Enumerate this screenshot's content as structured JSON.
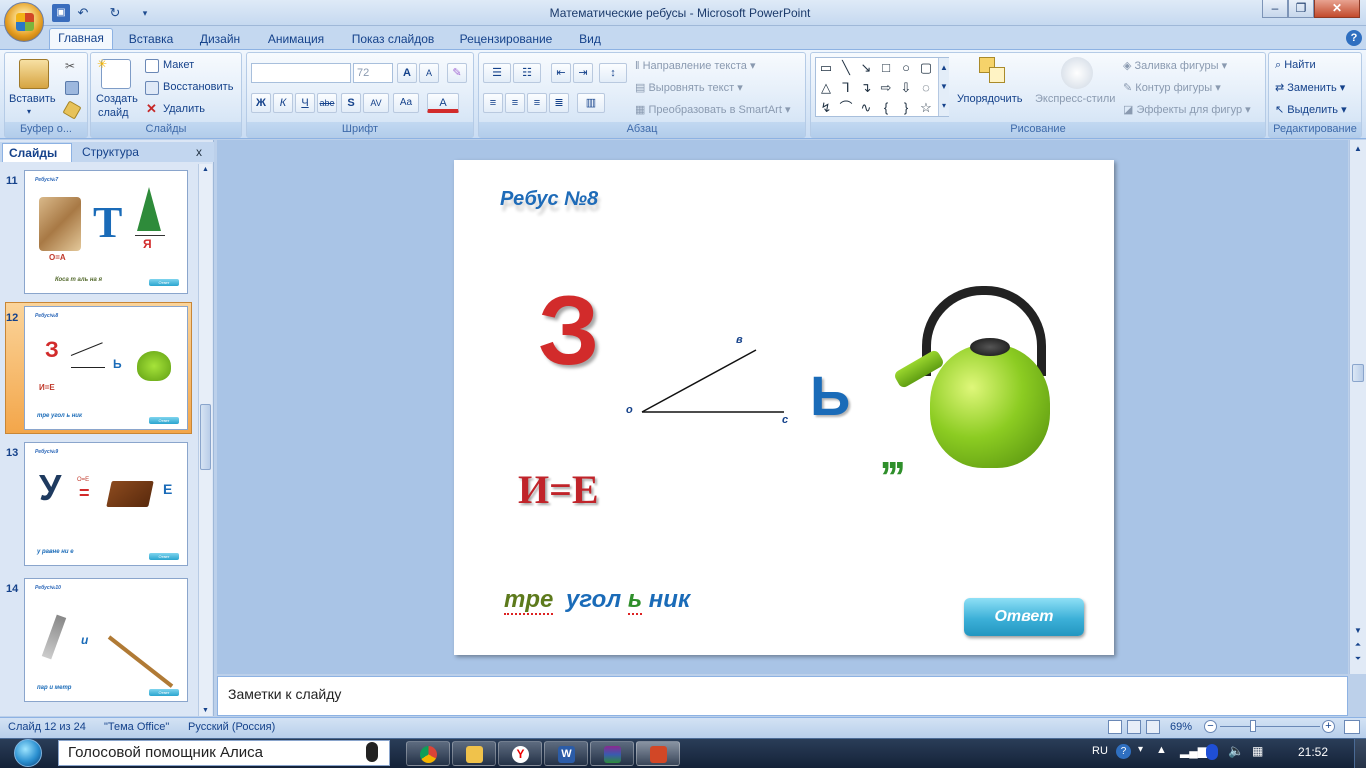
{
  "window": {
    "title": "Математические ребусы - Microsoft PowerPoint",
    "controls": [
      "–",
      "❐",
      "✕"
    ]
  },
  "quick_access": {
    "save_icon": "save-icon",
    "undo_icon": "undo-icon",
    "redo_icon": "redo-icon"
  },
  "tabs": [
    "Главная",
    "Вставка",
    "Дизайн",
    "Анимация",
    "Показ слайдов",
    "Рецензирование",
    "Вид"
  ],
  "ribbon": {
    "clipboard": {
      "paste": "Вставить",
      "label": "Буфер о..."
    },
    "slides": {
      "new_slide_line1": "Создать",
      "new_slide_line2": "слайд",
      "layout": "Макет",
      "reset": "Восстановить",
      "delete": "Удалить",
      "label": "Слайды"
    },
    "font": {
      "size": "72",
      "grow": "A",
      "shrink": "A",
      "bold": "Ж",
      "italic": "К",
      "underline": "Ч",
      "strike": "abe",
      "shadow": "S",
      "spacing": "AV",
      "case": "Aa",
      "color": "A",
      "label": "Шрифт"
    },
    "paragraph": {
      "text_direction": "Направление текста",
      "align_text": "Выровнять текст",
      "smartart": "Преобразовать в SmartArt",
      "label": "Абзац"
    },
    "drawing": {
      "arrange": "Упорядочить",
      "quick_styles": "Экспресс-стили",
      "fill": "Заливка фигуры",
      "outline": "Контур фигуры",
      "effects": "Эффекты для фигур",
      "label": "Рисование"
    },
    "editing": {
      "find": "Найти",
      "replace": "Заменить",
      "select": "Выделить",
      "label": "Редактирование"
    }
  },
  "left_pane": {
    "tab_slides": "Слайды",
    "tab_outline": "Структура",
    "close": "x"
  },
  "thumbnails": [
    {
      "num": "11",
      "title": "Ребус№7",
      "letter": "Т",
      "under": "Я",
      "eq": "О=А",
      "word": "Коса т аль на я",
      "btn": "Ответ"
    },
    {
      "num": "12",
      "title": "Ребус№8",
      "letter": "З",
      "b": "Ь",
      "eq": "И=Е",
      "word": "тре  угол ь ник",
      "btn": "Ответ"
    },
    {
      "num": "13",
      "title": "Ребус№9",
      "letter": "У",
      "eq": "О=Е",
      "e": "Е",
      "word": "у  равне ни е",
      "btn": "Ответ"
    },
    {
      "num": "14",
      "title": "Ребус№10",
      "i": "и",
      "word": "пар  и метр",
      "btn": "Ответ"
    }
  ],
  "slide": {
    "title": "Ребус №8",
    "big_letter": "З",
    "angle": {
      "o": "о",
      "b": "в",
      "c": "с"
    },
    "soft_sign": "Ь",
    "quotes": ",,,",
    "equation": "И=Е",
    "answer_part1": "тре",
    "answer_part2": "угол",
    "answer_part3": "ь",
    "answer_part4": "ник",
    "answer_button": "Ответ"
  },
  "notes": {
    "placeholder": "Заметки к слайду"
  },
  "status": {
    "slide": "Слайд 12 из 24",
    "theme": "\"Тема Office\"",
    "lang": "Русский (Россия)",
    "zoom": "69%"
  },
  "taskbar": {
    "assistant": "Голосовой помощник Алиса",
    "lang": "RU",
    "time": "21:52"
  },
  "colors": {
    "title_blue": "#1e6bb8",
    "red": "#d22b2b",
    "green": "#2f8f2b",
    "button": "#3cb0d8"
  }
}
